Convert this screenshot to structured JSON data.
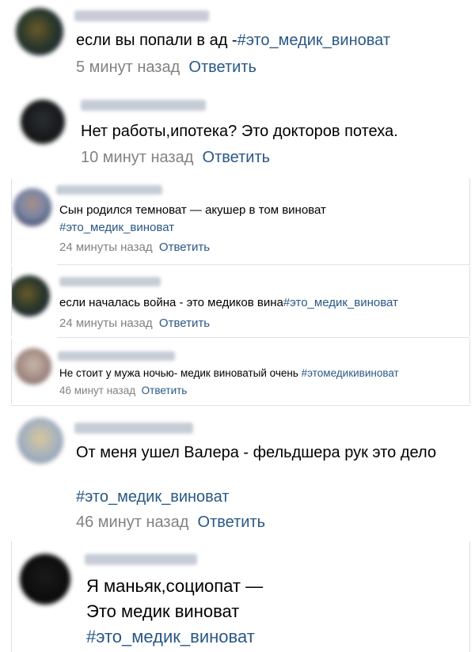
{
  "comments": [
    {
      "text": "если вы попали в ад -",
      "hashtag": "#это_медик_виноват",
      "time": "5 минут назад",
      "reply": "Ответить"
    },
    {
      "text": "Нет работы,ипотека? Это докторов потеха.",
      "time": "10 минут назад",
      "reply": "Ответить"
    },
    {
      "text": "Сын родился темноват — акушер в том виноват",
      "hashtag": "#это_медик_виноват",
      "time": "24 минуты назад",
      "reply": "Ответить"
    },
    {
      "text": "если началась война - это медиков вина",
      "hashtag": "#это_медик_виноват",
      "time": "24 минуты назад",
      "reply": "Ответить"
    },
    {
      "text": "Не стоит у мужа ночью- медик виноватый очень ",
      "hashtag": "#этомедикивиноват",
      "time": "46 минут назад",
      "reply": "Ответить"
    },
    {
      "text": "От меня ушел Валера - фельдшера рук это дело",
      "hashtag": "#это_медик_виноват",
      "time": "46 минут назад",
      "reply": "Ответить"
    },
    {
      "text_line1": "Я маньяк,социопат —",
      "text_line2": "Это медик виноват",
      "hashtag": "#это_медик_виноват"
    }
  ]
}
